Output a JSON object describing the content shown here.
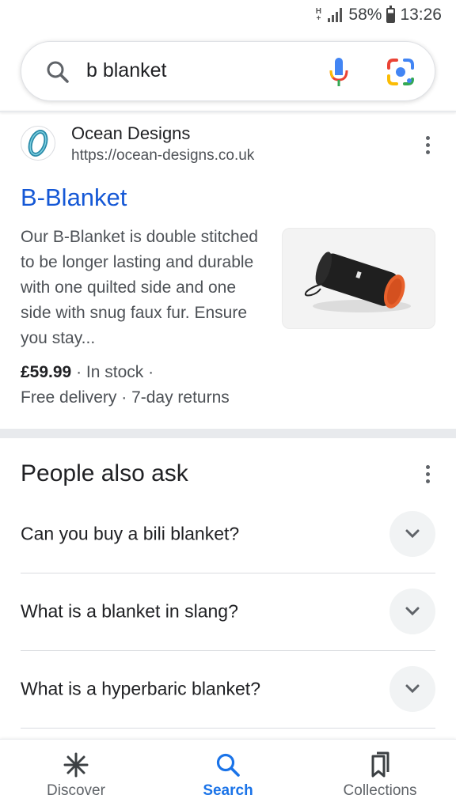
{
  "status_bar": {
    "network_type": "H",
    "battery_percent": "58%",
    "time": "13:26"
  },
  "search": {
    "query": "b blanket",
    "icons": [
      "search-icon",
      "microphone-icon",
      "google-lens-icon"
    ]
  },
  "result": {
    "site_name": "Ocean Designs",
    "site_url": "https://ocean-designs.co.uk",
    "title": "B-Blanket",
    "snippet": "Our B-Blanket is double stitched to be longer lasting and durable with one quilted side and one side with snug faux fur. Ensure you stay...",
    "price": "£59.99",
    "stock": "In stock",
    "delivery": "Free delivery",
    "returns": "7-day returns",
    "link_color": "#1558d6"
  },
  "paa": {
    "title": "People also ask",
    "questions": [
      "Can you buy a bili blanket?",
      "What is a blanket in slang?",
      "What is a hyperbaric blanket?"
    ]
  },
  "bottom_nav": {
    "items": [
      {
        "label": "Discover",
        "icon": "asterisk-icon",
        "active": false
      },
      {
        "label": "Search",
        "icon": "search-icon",
        "active": true
      },
      {
        "label": "Collections",
        "icon": "bookmarks-icon",
        "active": false
      }
    ],
    "active_color": "#1a73e8"
  }
}
